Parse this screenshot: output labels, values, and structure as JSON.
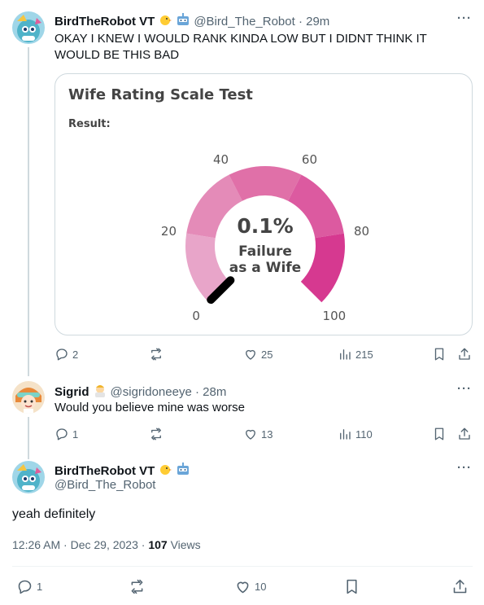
{
  "tweet1": {
    "display_name": "BirdTheRobot VT",
    "handle_time": "@Bird_The_Robot · 29m",
    "text": "OKAY I KNEW I WOULD RANK KINDA LOW BUT I DIDNT THINK IT WOULD BE THIS BAD",
    "card": {
      "title": "Wife Rating Scale Test",
      "result_label": "Result:",
      "gauge_value": "0.1%",
      "gauge_caption_line1": "Failure",
      "gauge_caption_line2": "as a Wife",
      "needle_fraction": 0.001,
      "ticks": [
        "0",
        "20",
        "40",
        "60",
        "80",
        "100"
      ],
      "segment_colors": [
        "#e8a5c9",
        "#e48bb8",
        "#e070a8",
        "#dc5aa0",
        "#d63990"
      ]
    },
    "replies": "2",
    "reposts": "",
    "likes": "25",
    "views": "215"
  },
  "tweet2": {
    "display_name": "Sigrid",
    "handle_time": "@sigridoneeye · 28m",
    "text": "Would you believe mine was worse",
    "replies": "1",
    "reposts": "",
    "likes": "13",
    "views": "110"
  },
  "tweet3": {
    "display_name": "BirdTheRobot VT",
    "handle": "@Bird_The_Robot",
    "text": "yeah definitely",
    "timestamp": "12:26 AM · Dec 29, 2023 · ",
    "views_count": "107",
    "views_label": " Views",
    "replies": "1",
    "likes": "10"
  },
  "icons": {
    "more": "more-icon",
    "reply": "reply-icon",
    "repost": "repost-icon",
    "like": "heart-icon",
    "views": "views-icon",
    "bookmark": "bookmark-icon",
    "share": "share-icon"
  },
  "colors": {
    "text_secondary": "#536471",
    "border": "#cfd9de",
    "gauge_needle": "#000000"
  }
}
